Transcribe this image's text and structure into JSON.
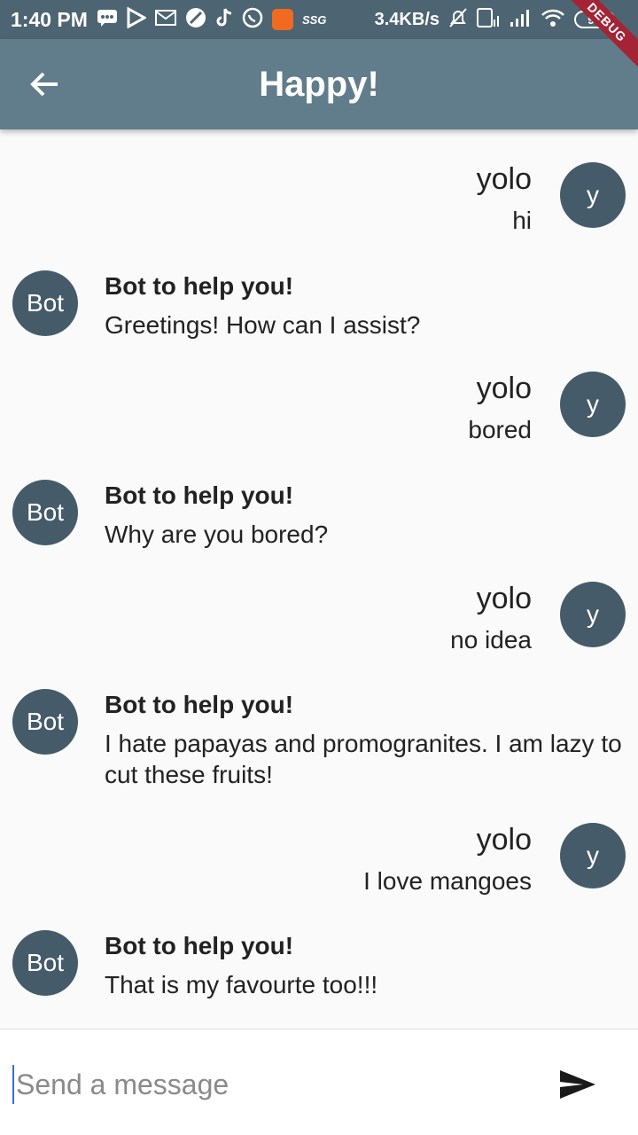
{
  "status_bar": {
    "time": "1:40 PM",
    "small_label": "SSG",
    "speed": "3.4KB/s",
    "battery": "98",
    "debug": "DEBUG",
    "icons": [
      "chat-icon",
      "play-icon",
      "mail-icon",
      "compass-icon",
      "tiktok-icon",
      "whatsapp-icon",
      "app-icon",
      "mute-icon",
      "volte-icon",
      "signal-icon",
      "signal-icon",
      "wifi-icon"
    ]
  },
  "app_bar": {
    "title": "Happy!",
    "back_icon": "arrow-back-icon"
  },
  "messages": [
    {
      "sender": "user",
      "name": "yolo",
      "avatar": "y",
      "text": "hi"
    },
    {
      "sender": "bot",
      "name": "Bot to help you!",
      "avatar": "Bot",
      "text": "Greetings! How can I assist?"
    },
    {
      "sender": "user",
      "name": "yolo",
      "avatar": "y",
      "text": "bored"
    },
    {
      "sender": "bot",
      "name": "Bot to help you!",
      "avatar": "Bot",
      "text": "Why are you bored?"
    },
    {
      "sender": "user",
      "name": "yolo",
      "avatar": "y",
      "text": "no idea"
    },
    {
      "sender": "bot",
      "name": "Bot to help you!",
      "avatar": "Bot",
      "text": "I hate papayas and promogranites. I am lazy to cut these fruits!"
    },
    {
      "sender": "user",
      "name": "yolo",
      "avatar": "y",
      "text": "I love mangoes"
    },
    {
      "sender": "bot",
      "name": "Bot to help you!",
      "avatar": "Bot",
      "text": "That is my favourte too!!!"
    }
  ],
  "composer": {
    "placeholder": "Send a message",
    "value": "",
    "send_icon": "send-icon"
  },
  "colors": {
    "status_bar": "#4d6472",
    "app_bar": "#617d8b",
    "avatar": "#455b69",
    "background": "#fafafa",
    "debug_ribbon": "#a32535"
  }
}
